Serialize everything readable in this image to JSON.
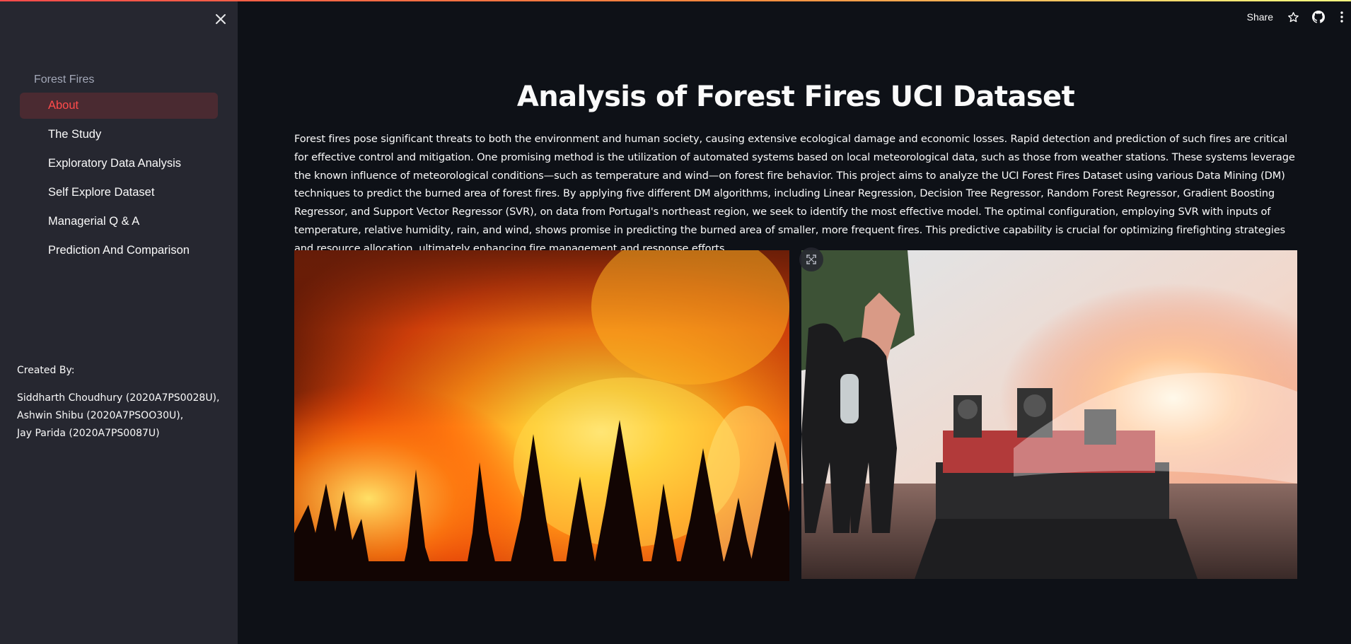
{
  "sidebar": {
    "nav_title": "Forest Fires",
    "items": [
      {
        "label": "About",
        "active": true
      },
      {
        "label": "The Study",
        "active": false
      },
      {
        "label": "Exploratory Data Analysis",
        "active": false
      },
      {
        "label": "Self Explore Dataset",
        "active": false
      },
      {
        "label": "Managerial Q & A",
        "active": false
      },
      {
        "label": "Prediction And Comparison",
        "active": false
      }
    ],
    "created_by_label": "Created By:",
    "authors": [
      "Siddharth Choudhury (2020A7PS0028U),",
      "Ashwin Shibu (2020A7PSOO30U),",
      "Jay Parida (2020A7PS0087U)"
    ],
    "close_icon": "close-icon"
  },
  "header": {
    "share_label": "Share",
    "icons": [
      "star-icon",
      "github-icon",
      "more-vertical-icon"
    ]
  },
  "main": {
    "title": "Analysis of Forest Fires UCI Dataset",
    "intro": "Forest fires pose significant threats to both the environment and human society, causing extensive ecological damage and economic losses. Rapid detection and prediction of such fires are critical for effective control and mitigation. One promising method is the utilization of automated systems based on local meteorological data, such as those from weather stations. These systems leverage the known influence of meteorological conditions—such as temperature and wind—on forest fire behavior. This project aims to analyze the UCI Forest Fires Dataset using various Data Mining (DM) techniques to predict the burned area of forest fires. By applying five different DM algorithms, including Linear Regression, Decision Tree Regressor, Random Forest Regressor, Gradient Boosting Regressor, and Support Vector Regressor (SVR), on data from Portugal's northeast region, we seek to identify the most effective model. The optimal configuration, employing SVR with inputs of temperature, relative humidity, rain, and wind, shows promise in predicting the burned area of smaller, more frequent fires. This predictive capability is crucial for optimizing firefighting strategies and resource allocation, ultimately enhancing fire management and response efforts.",
    "images": [
      "forest-fire-photo",
      "firefighters-robot-photo"
    ]
  },
  "colors": {
    "accent": "#ff4b4b",
    "background": "#0e1117",
    "sidebar": "#262730"
  }
}
